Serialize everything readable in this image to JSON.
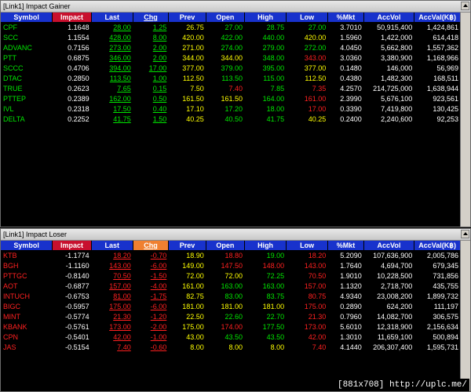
{
  "gainer": {
    "title": "[Link1] Impact Gainer",
    "headers": [
      "Symbol",
      "Impact",
      "Last",
      "Chg",
      "Prev",
      "Open",
      "High",
      "Low",
      "%Mkt",
      "AccVol",
      "AccVal(K฿)"
    ],
    "rows": [
      {
        "symbol": "CPF",
        "impact": "1.1648",
        "last": "28.00",
        "chg": "1.25",
        "prev": "26.75",
        "open": "27.00",
        "high": "28.75",
        "low": "27.00",
        "mkt": "3.7010",
        "accvol": "50,915,400",
        "accval": "1,424,861"
      },
      {
        "symbol": "SCC",
        "impact": "1.1554",
        "last": "428.00",
        "chg": "8.00",
        "prev": "420.00",
        "open": "422.00",
        "high": "440.00",
        "low": "420.00",
        "mkt": "1.5960",
        "accvol": "1,422,000",
        "accval": "614,418"
      },
      {
        "symbol": "ADVANC",
        "impact": "0.7156",
        "last": "273.00",
        "chg": "2.00",
        "prev": "271.00",
        "open": "274.00",
        "high": "279.00",
        "low": "272.00",
        "mkt": "4.0450",
        "accvol": "5,662,800",
        "accval": "1,557,362"
      },
      {
        "symbol": "PTT",
        "impact": "0.6875",
        "last": "346.00",
        "chg": "2.00",
        "prev": "344.00",
        "open": "344.00",
        "high": "348.00",
        "low": "343.00",
        "mkt": "3.0360",
        "accvol": "3,380,900",
        "accval": "1,168,966"
      },
      {
        "symbol": "SCCC",
        "impact": "0.4706",
        "last": "394.00",
        "chg": "17.00",
        "prev": "377.00",
        "open": "379.00",
        "high": "395.00",
        "low": "377.00",
        "mkt": "0.1480",
        "accvol": "146,000",
        "accval": "56,969"
      },
      {
        "symbol": "DTAC",
        "impact": "0.2850",
        "last": "113.50",
        "chg": "1.00",
        "prev": "112.50",
        "open": "113.50",
        "high": "115.00",
        "low": "112.50",
        "mkt": "0.4380",
        "accvol": "1,482,300",
        "accval": "168,511"
      },
      {
        "symbol": "TRUE",
        "impact": "0.2623",
        "last": "7.65",
        "chg": "0.15",
        "prev": "7.50",
        "open": "7.40",
        "high": "7.85",
        "low": "7.35",
        "mkt": "4.2570",
        "accvol": "214,725,000",
        "accval": "1,638,944"
      },
      {
        "symbol": "PTTEP",
        "impact": "0.2389",
        "last": "162.00",
        "chg": "0.50",
        "prev": "161.50",
        "open": "161.50",
        "high": "164.00",
        "low": "161.00",
        "mkt": "2.3990",
        "accvol": "5,676,100",
        "accval": "923,561"
      },
      {
        "symbol": "IVL",
        "impact": "0.2318",
        "last": "17.50",
        "chg": "0.40",
        "prev": "17.10",
        "open": "17.20",
        "high": "18.00",
        "low": "17.00",
        "mkt": "0.3390",
        "accvol": "7,419,800",
        "accval": "130,425"
      },
      {
        "symbol": "DELTA",
        "impact": "0.2252",
        "last": "41.75",
        "chg": "1.50",
        "prev": "40.25",
        "open": "40.50",
        "high": "41.75",
        "low": "40.25",
        "mkt": "0.2400",
        "accvol": "2,240,600",
        "accval": "92,253"
      }
    ]
  },
  "loser": {
    "title": "[Link1] Impact Loser",
    "headers": [
      "Symbol",
      "Impact",
      "Last",
      "Chg",
      "Prev",
      "Open",
      "High",
      "Low",
      "%Mkt",
      "AccVol",
      "AccVal(K฿)"
    ],
    "rows": [
      {
        "symbol": "KTB",
        "impact": "-1.1774",
        "last": "18.20",
        "chg": "-0.70",
        "prev": "18.90",
        "open": "18.80",
        "high": "19.00",
        "low": "18.20",
        "mkt": "5.2090",
        "accvol": "107,636,900",
        "accval": "2,005,786"
      },
      {
        "symbol": "BGH",
        "impact": "-1.1160",
        "last": "143.00",
        "chg": "-6.00",
        "prev": "149.00",
        "open": "147.50",
        "high": "148.00",
        "low": "143.00",
        "mkt": "1.7640",
        "accvol": "4,694,700",
        "accval": "679,345"
      },
      {
        "symbol": "PTTGC",
        "impact": "-0.8140",
        "last": "70.50",
        "chg": "-1.50",
        "prev": "72.00",
        "open": "72.00",
        "high": "72.25",
        "low": "70.50",
        "mkt": "1.9010",
        "accvol": "10,228,500",
        "accval": "731,856"
      },
      {
        "symbol": "AOT",
        "impact": "-0.6877",
        "last": "157.00",
        "chg": "-4.00",
        "prev": "161.00",
        "open": "163.00",
        "high": "163.00",
        "low": "157.00",
        "mkt": "1.1320",
        "accvol": "2,718,700",
        "accval": "435,755"
      },
      {
        "symbol": "INTUCH",
        "impact": "-0.6753",
        "last": "81.00",
        "chg": "-1.75",
        "prev": "82.75",
        "open": "83.00",
        "high": "83.75",
        "low": "80.75",
        "mkt": "4.9340",
        "accvol": "23,008,200",
        "accval": "1,899,732"
      },
      {
        "symbol": "BIGC",
        "impact": "-0.5957",
        "last": "175.00",
        "chg": "-6.00",
        "prev": "181.00",
        "open": "181.00",
        "high": "181.00",
        "low": "175.00",
        "mkt": "0.2890",
        "accvol": "624,200",
        "accval": "111,197"
      },
      {
        "symbol": "MINT",
        "impact": "-0.5774",
        "last": "21.30",
        "chg": "-1.20",
        "prev": "22.50",
        "open": "22.60",
        "high": "22.70",
        "low": "21.30",
        "mkt": "0.7960",
        "accvol": "14,082,700",
        "accval": "306,575"
      },
      {
        "symbol": "KBANK",
        "impact": "-0.5761",
        "last": "173.00",
        "chg": "-2.00",
        "prev": "175.00",
        "open": "174.00",
        "high": "177.50",
        "low": "173.00",
        "mkt": "5.6010",
        "accvol": "12,318,900",
        "accval": "2,156,634"
      },
      {
        "symbol": "CPN",
        "impact": "-0.5401",
        "last": "42.00",
        "chg": "-1.00",
        "prev": "43.00",
        "open": "43.50",
        "high": "43.50",
        "low": "42.00",
        "mkt": "1.3010",
        "accvol": "11,659,100",
        "accval": "500,894"
      },
      {
        "symbol": "JAS",
        "impact": "-0.5154",
        "last": "7.40",
        "chg": "-0.60",
        "prev": "8.00",
        "open": "8.00",
        "high": "8.00",
        "low": "7.40",
        "mkt": "4.1440",
        "accvol": "206,307,400",
        "accval": "1,595,731"
      }
    ]
  },
  "watermark": "[881x708] http://uplc.me/"
}
